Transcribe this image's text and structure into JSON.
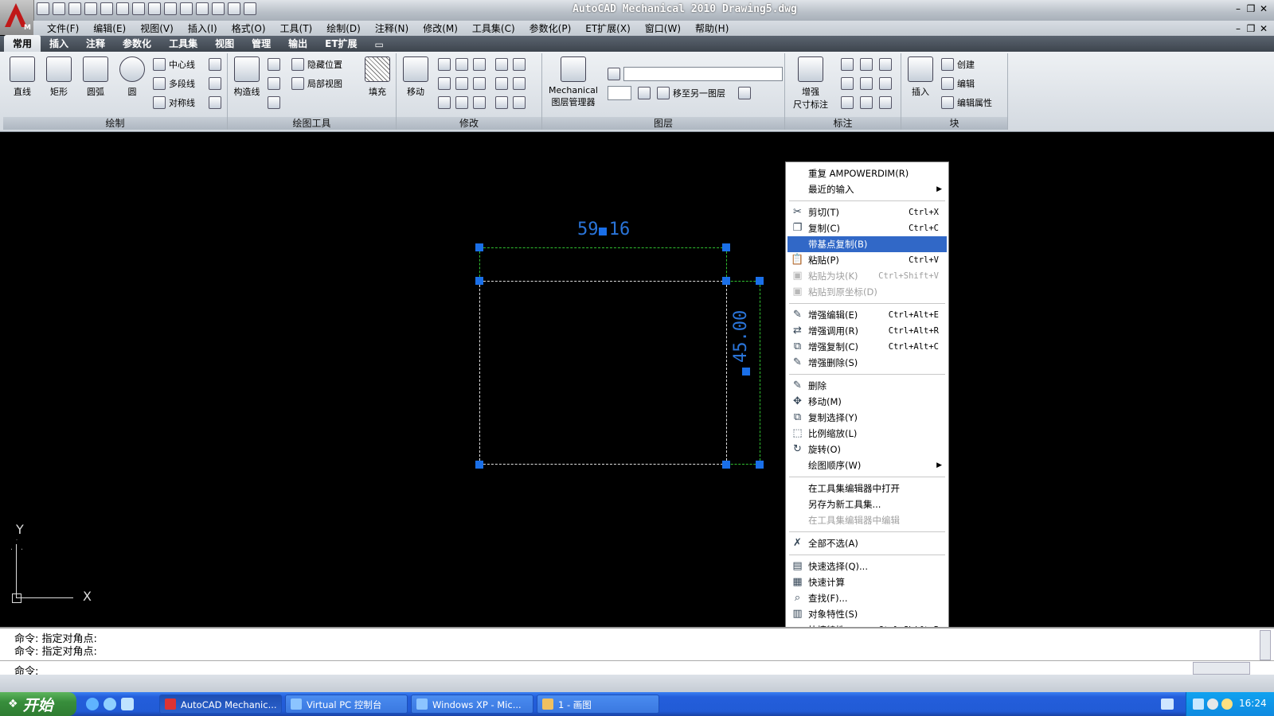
{
  "window": {
    "title": "AutoCAD Mechanical 2010   Drawing5.dwg",
    "minimize": "–",
    "restore": "❐",
    "close": "✕"
  },
  "menubar": {
    "items": [
      "文件(F)",
      "编辑(E)",
      "视图(V)",
      "插入(I)",
      "格式(O)",
      "工具(T)",
      "绘制(D)",
      "注释(N)",
      "修改(M)",
      "工具集(C)",
      "参数化(P)",
      "ET扩展(X)",
      "窗口(W)",
      "帮助(H)"
    ]
  },
  "ribbon": {
    "tabs": [
      "常用",
      "插入",
      "注释",
      "参数化",
      "工具集",
      "视图",
      "管理",
      "输出",
      "ET扩展"
    ],
    "active_tab": "常用",
    "panels": {
      "draw": {
        "title": "绘制",
        "line": "直线",
        "rect": "矩形",
        "arc": "圆弧",
        "circle": "圆",
        "centerline": "中心线",
        "polyline": "多段线",
        "symline": "对称线"
      },
      "drawtools": {
        "title": "绘图工具",
        "construct": "构造线",
        "hide": "隐藏位置",
        "detail": "局部视图",
        "fill": "填充"
      },
      "modify": {
        "title": "修改",
        "move": "移动"
      },
      "layers": {
        "title": "图层",
        "manager1": "Mechanical",
        "manager2": "图层管理器",
        "movelayer": "移至另一图层"
      },
      "dims": {
        "title": "标注",
        "enhanced1": "增强",
        "enhanced2": "尺寸标注"
      },
      "block": {
        "title": "块",
        "insert": "插入",
        "create": "创建",
        "edit": "编辑",
        "editattr": "编辑属性"
      }
    }
  },
  "drawing": {
    "dim_horizontal": "59.16",
    "dim_vertical": "45.00",
    "ucs_x": "X",
    "ucs_y": "Y",
    "colors": {
      "grip": "#1a6fe8",
      "dim": "#2a74d8"
    }
  },
  "context_menu": {
    "items": [
      {
        "label": "重复 AMPOWERDIM(R)",
        "shortcut": "",
        "icon": "none",
        "disabled": false
      },
      {
        "label": "最近的输入",
        "shortcut": "",
        "icon": "none",
        "submenu": true
      },
      {
        "sep": true
      },
      {
        "label": "剪切(T)",
        "shortcut": "Ctrl+X",
        "icon": "scissors-icon",
        "glyph": "✂"
      },
      {
        "label": "复制(C)",
        "shortcut": "Ctrl+C",
        "icon": "copy-icon",
        "glyph": "❐"
      },
      {
        "label": "带基点复制(B)",
        "shortcut": "",
        "icon": "none",
        "highlighted": true
      },
      {
        "label": "粘贴(P)",
        "shortcut": "Ctrl+V",
        "icon": "paste-icon",
        "glyph": "📋"
      },
      {
        "label": "粘贴为块(K)",
        "shortcut": "Ctrl+Shift+V",
        "icon": "paste-block-icon",
        "glyph": "▣",
        "disabled": true
      },
      {
        "label": "粘贴到原坐标(D)",
        "shortcut": "",
        "icon": "paste-coord-icon",
        "glyph": "▣",
        "disabled": true
      },
      {
        "sep": true
      },
      {
        "label": "增强编辑(E)",
        "shortcut": "Ctrl+Alt+E",
        "icon": "enhanced-edit-icon",
        "glyph": "✎"
      },
      {
        "label": "增强调用(R)",
        "shortcut": "Ctrl+Alt+R",
        "icon": "enhanced-call-icon",
        "glyph": "⇄"
      },
      {
        "label": "增强复制(C)",
        "shortcut": "Ctrl+Alt+C",
        "icon": "enhanced-copy-icon",
        "glyph": "⧉"
      },
      {
        "label": "增强删除(S)",
        "shortcut": "",
        "icon": "enhanced-delete-icon",
        "glyph": "✎"
      },
      {
        "sep": true
      },
      {
        "label": "删除",
        "shortcut": "",
        "icon": "erase-icon",
        "glyph": "✎"
      },
      {
        "label": "移动(M)",
        "shortcut": "",
        "icon": "move-icon",
        "glyph": "✥"
      },
      {
        "label": "复制选择(Y)",
        "shortcut": "",
        "icon": "copy-selection-icon",
        "glyph": "⧉"
      },
      {
        "label": "比例缩放(L)",
        "shortcut": "",
        "icon": "scale-icon",
        "glyph": "⬚"
      },
      {
        "label": "旋转(O)",
        "shortcut": "",
        "icon": "rotate-icon",
        "glyph": "↻"
      },
      {
        "label": "绘图顺序(W)",
        "shortcut": "",
        "icon": "none",
        "submenu": true
      },
      {
        "sep": true
      },
      {
        "label": "在工具集编辑器中打开",
        "shortcut": "",
        "icon": "none"
      },
      {
        "label": "另存为新工具集...",
        "shortcut": "",
        "icon": "none"
      },
      {
        "label": "在工具集编辑器中编辑",
        "shortcut": "",
        "icon": "none",
        "disabled": true
      },
      {
        "sep": true
      },
      {
        "label": "全部不选(A)",
        "shortcut": "",
        "icon": "deselect-icon",
        "glyph": "✗"
      },
      {
        "sep": true
      },
      {
        "label": "快速选择(Q)...",
        "shortcut": "",
        "icon": "quick-select-icon",
        "glyph": "▤"
      },
      {
        "label": "快速计算",
        "shortcut": "",
        "icon": "calculator-icon",
        "glyph": "▦"
      },
      {
        "label": "查找(F)...",
        "shortcut": "",
        "icon": "find-icon",
        "glyph": "⌕"
      },
      {
        "label": "对象特性(S)",
        "shortcut": "",
        "icon": "properties-icon",
        "glyph": "▥"
      },
      {
        "label": "快捷特性",
        "shortcut": "Ctrl+Shift+P",
        "icon": "none"
      }
    ]
  },
  "command": {
    "line1": "命令: 指定对角点:",
    "line2": "命令: 指定对角点:",
    "prompt": "命令:"
  },
  "taskbar": {
    "start": "开始",
    "buttons": [
      "AutoCAD Mechanic...",
      "Virtual PC 控制台",
      "Windows XP - Mic...",
      "1 - 画图"
    ],
    "clock": "16:24"
  }
}
